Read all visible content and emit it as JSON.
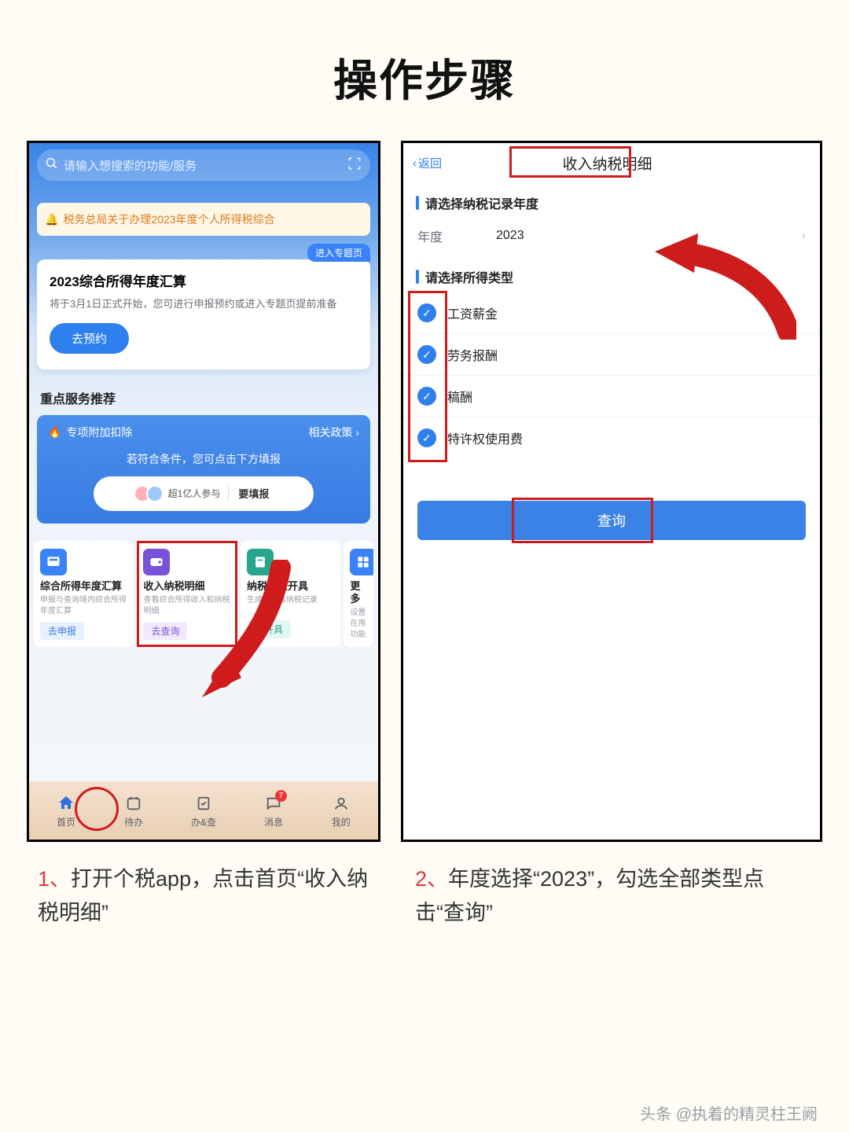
{
  "title": "操作步骤",
  "left": {
    "search_placeholder": "请输入想搜索的功能/服务",
    "notice": "税务总局关于办理2023年度个人所得税综合",
    "card1": {
      "tag": "进入专题页",
      "title": "2023综合所得年度汇算",
      "desc": "将于3月1日正式开始，您可进行申报预约或进入专题页提前准备",
      "btn": "去预约"
    },
    "section_title": "重点服务推荐",
    "bluecard": {
      "special": "专项附加扣除",
      "policy": "相关政策",
      "hint": "若符合条件，您可点击下方填报",
      "count_label": "超1亿人参与",
      "want_label": "要填报"
    },
    "tiles": [
      {
        "title": "综合所得年度汇算",
        "desc": "申报与查询境内综合所得年度汇算",
        "btn": "去申报"
      },
      {
        "title": "收入纳税明细",
        "desc": "查看综合所得收入和纳税明细",
        "btn": "去查询"
      },
      {
        "title": "纳税记录开具",
        "desc": "生成或查看纳税记录",
        "btn": "去开具"
      },
      {
        "title": "更多",
        "desc": "设置在用功能",
        "btn": ""
      }
    ],
    "nav": [
      {
        "label": "首页"
      },
      {
        "label": "待办"
      },
      {
        "label": "办&查"
      },
      {
        "label": "消息",
        "badge": "7"
      },
      {
        "label": "我的"
      }
    ]
  },
  "right": {
    "back": "返回",
    "title": "收入纳税明细",
    "section_year": "请选择纳税记录年度",
    "year_label": "年度",
    "year_value": "2023",
    "section_type": "请选择所得类型",
    "types": [
      "工资薪金",
      "劳务报酬",
      "稿酬",
      "特许权使用费"
    ],
    "query": "查询"
  },
  "captions": {
    "c1": "1、打开个税app，点击首页“收入纳税明细”",
    "c2": "2、年度选择“2023”，勾选全部类型点击“查询”"
  },
  "watermark": "头条 @执着的精灵柱王阙"
}
